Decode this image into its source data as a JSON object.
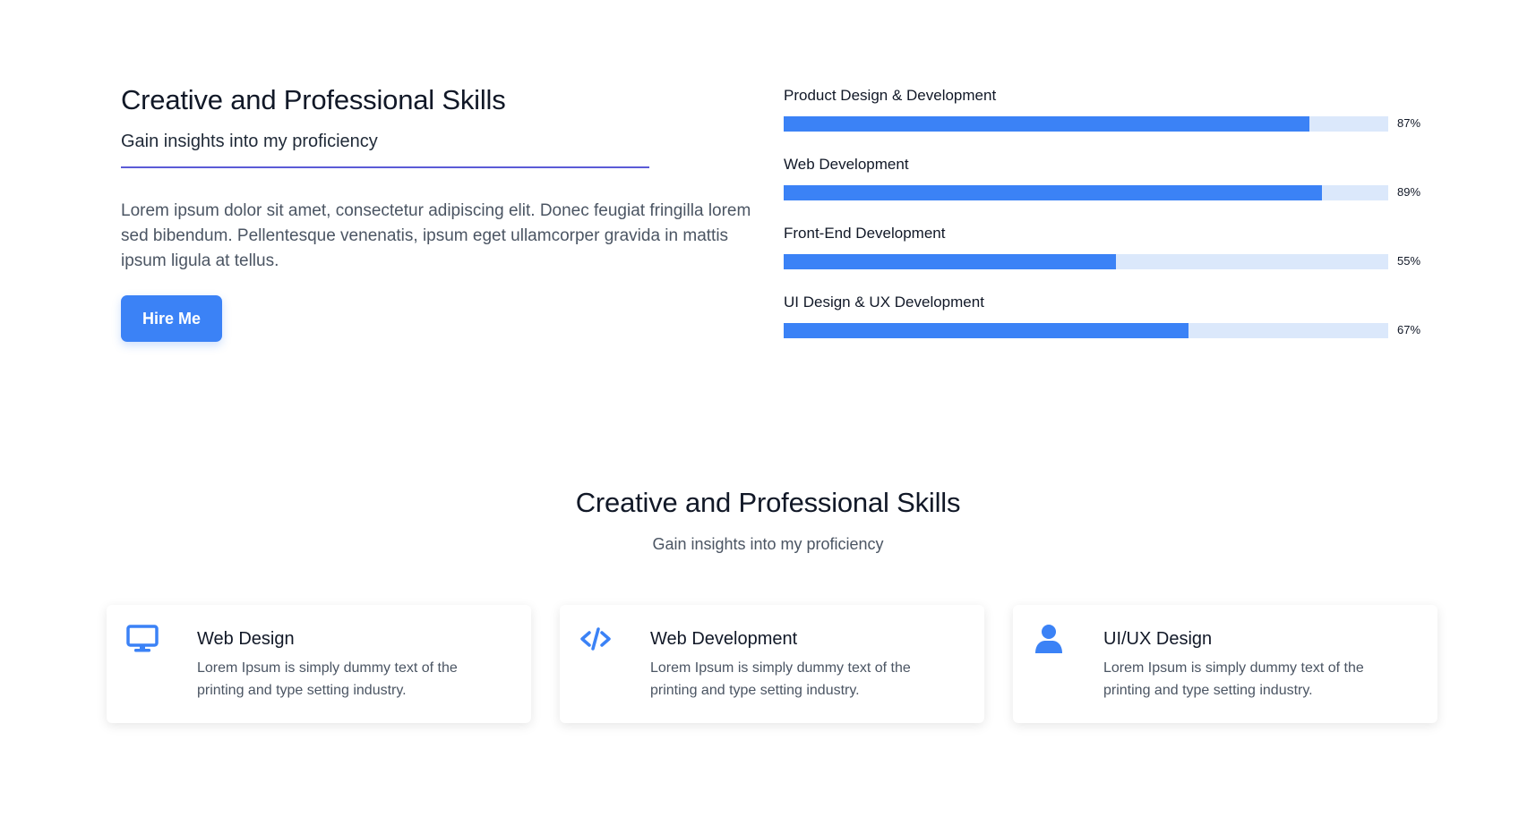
{
  "intro": {
    "title": "Creative and Professional Skills",
    "subtitle": "Gain insights into my proficiency",
    "body": "Lorem ipsum dolor sit amet, consectetur adipiscing elit. Donec feugiat fringilla lorem sed bibendum. Pellentesque venenatis, ipsum eget ullamcorper gravida in mattis ipsum ligula at tellus.",
    "button_label": "Hire Me"
  },
  "skills": [
    {
      "label": "Product Design & Development",
      "percent": 87,
      "percent_label": "87%"
    },
    {
      "label": "Web Development",
      "percent": 89,
      "percent_label": "89%"
    },
    {
      "label": "Front-End Development",
      "percent": 55,
      "percent_label": "55%"
    },
    {
      "label": "UI Design & UX Development",
      "percent": 67,
      "percent_label": "67%"
    }
  ],
  "services": {
    "title": "Creative and Professional Skills",
    "subtitle": "Gain insights into my proficiency",
    "cards": [
      {
        "icon": "monitor-icon",
        "title": "Web Design",
        "description": "Lorem Ipsum is simply dummy text of the printing and type setting industry."
      },
      {
        "icon": "code-icon",
        "title": "Web Development",
        "description": "Lorem Ipsum is simply dummy text of the printing and type setting industry."
      },
      {
        "icon": "user-icon",
        "title": "UI/UX Design",
        "description": "Lorem Ipsum is simply dummy text of the printing and type setting industry."
      }
    ]
  },
  "colors": {
    "accent": "#3b82f6",
    "track": "#dbe8fb",
    "divider": "#5b5bd6"
  }
}
